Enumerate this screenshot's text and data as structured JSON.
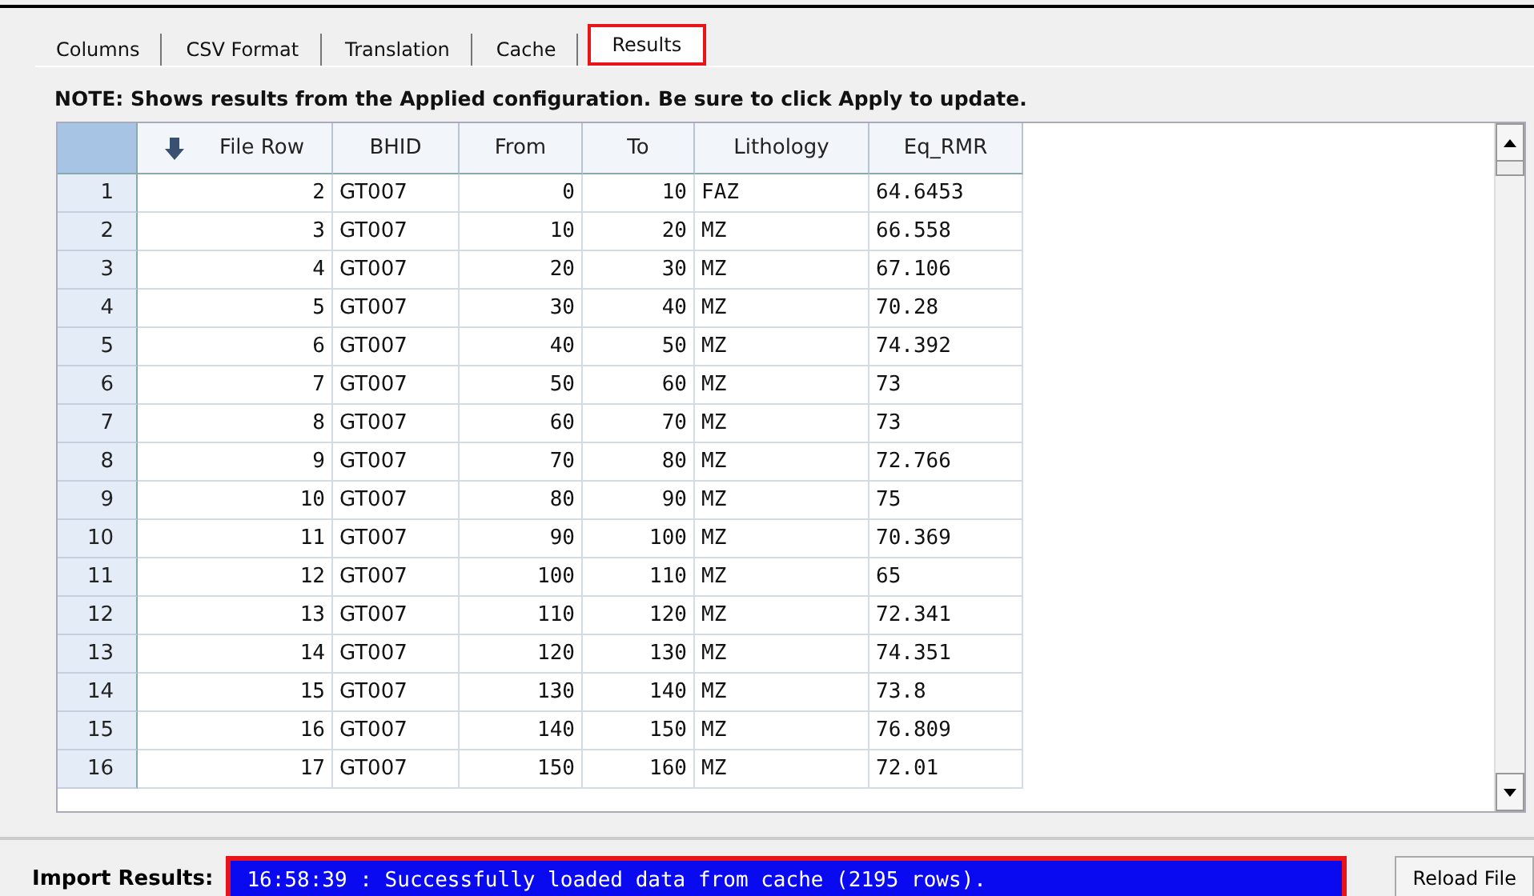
{
  "tabs": [
    {
      "label": "Columns",
      "selected": false,
      "highlighted": false
    },
    {
      "label": "CSV Format",
      "selected": false,
      "highlighted": false
    },
    {
      "label": "Translation",
      "selected": false,
      "highlighted": false
    },
    {
      "label": "Cache",
      "selected": false,
      "highlighted": false
    },
    {
      "label": "Results",
      "selected": true,
      "highlighted": true
    }
  ],
  "note": "NOTE: Shows results from the Applied configuration. Be sure to click Apply to update.",
  "table": {
    "columns": [
      {
        "label": "File Row",
        "sorted": true
      },
      {
        "label": "BHID",
        "sorted": false
      },
      {
        "label": "From",
        "sorted": false
      },
      {
        "label": "To",
        "sorted": false
      },
      {
        "label": "Lithology",
        "sorted": false
      },
      {
        "label": "Eq_RMR",
        "sorted": false
      }
    ],
    "rows": [
      {
        "index": "1",
        "cells": [
          "2",
          "GT007",
          "0",
          "10",
          "FAZ",
          "64.6453"
        ]
      },
      {
        "index": "2",
        "cells": [
          "3",
          "GT007",
          "10",
          "20",
          "MZ",
          "66.558"
        ]
      },
      {
        "index": "3",
        "cells": [
          "4",
          "GT007",
          "20",
          "30",
          "MZ",
          "67.106"
        ]
      },
      {
        "index": "4",
        "cells": [
          "5",
          "GT007",
          "30",
          "40",
          "MZ",
          "70.28"
        ]
      },
      {
        "index": "5",
        "cells": [
          "6",
          "GT007",
          "40",
          "50",
          "MZ",
          "74.392"
        ]
      },
      {
        "index": "6",
        "cells": [
          "7",
          "GT007",
          "50",
          "60",
          "MZ",
          "73"
        ]
      },
      {
        "index": "7",
        "cells": [
          "8",
          "GT007",
          "60",
          "70",
          "MZ",
          "73"
        ]
      },
      {
        "index": "8",
        "cells": [
          "9",
          "GT007",
          "70",
          "80",
          "MZ",
          "72.766"
        ]
      },
      {
        "index": "9",
        "cells": [
          "10",
          "GT007",
          "80",
          "90",
          "MZ",
          "75"
        ]
      },
      {
        "index": "10",
        "cells": [
          "11",
          "GT007",
          "90",
          "100",
          "MZ",
          "70.369"
        ]
      },
      {
        "index": "11",
        "cells": [
          "12",
          "GT007",
          "100",
          "110",
          "MZ",
          "65"
        ]
      },
      {
        "index": "12",
        "cells": [
          "13",
          "GT007",
          "110",
          "120",
          "MZ",
          "72.341"
        ]
      },
      {
        "index": "13",
        "cells": [
          "14",
          "GT007",
          "120",
          "130",
          "MZ",
          "74.351"
        ]
      },
      {
        "index": "14",
        "cells": [
          "15",
          "GT007",
          "130",
          "140",
          "MZ",
          "73.8"
        ]
      },
      {
        "index": "15",
        "cells": [
          "16",
          "GT007",
          "140",
          "150",
          "MZ",
          "76.809"
        ]
      },
      {
        "index": "16",
        "cells": [
          "17",
          "GT007",
          "150",
          "160",
          "MZ",
          "72.01"
        ]
      }
    ]
  },
  "import_results": {
    "label": "Import Results:",
    "message": "16:58:39 : Successfully loaded data from cache (2195 rows).",
    "highlighted": true
  },
  "buttons": [
    "Reload File"
  ]
}
